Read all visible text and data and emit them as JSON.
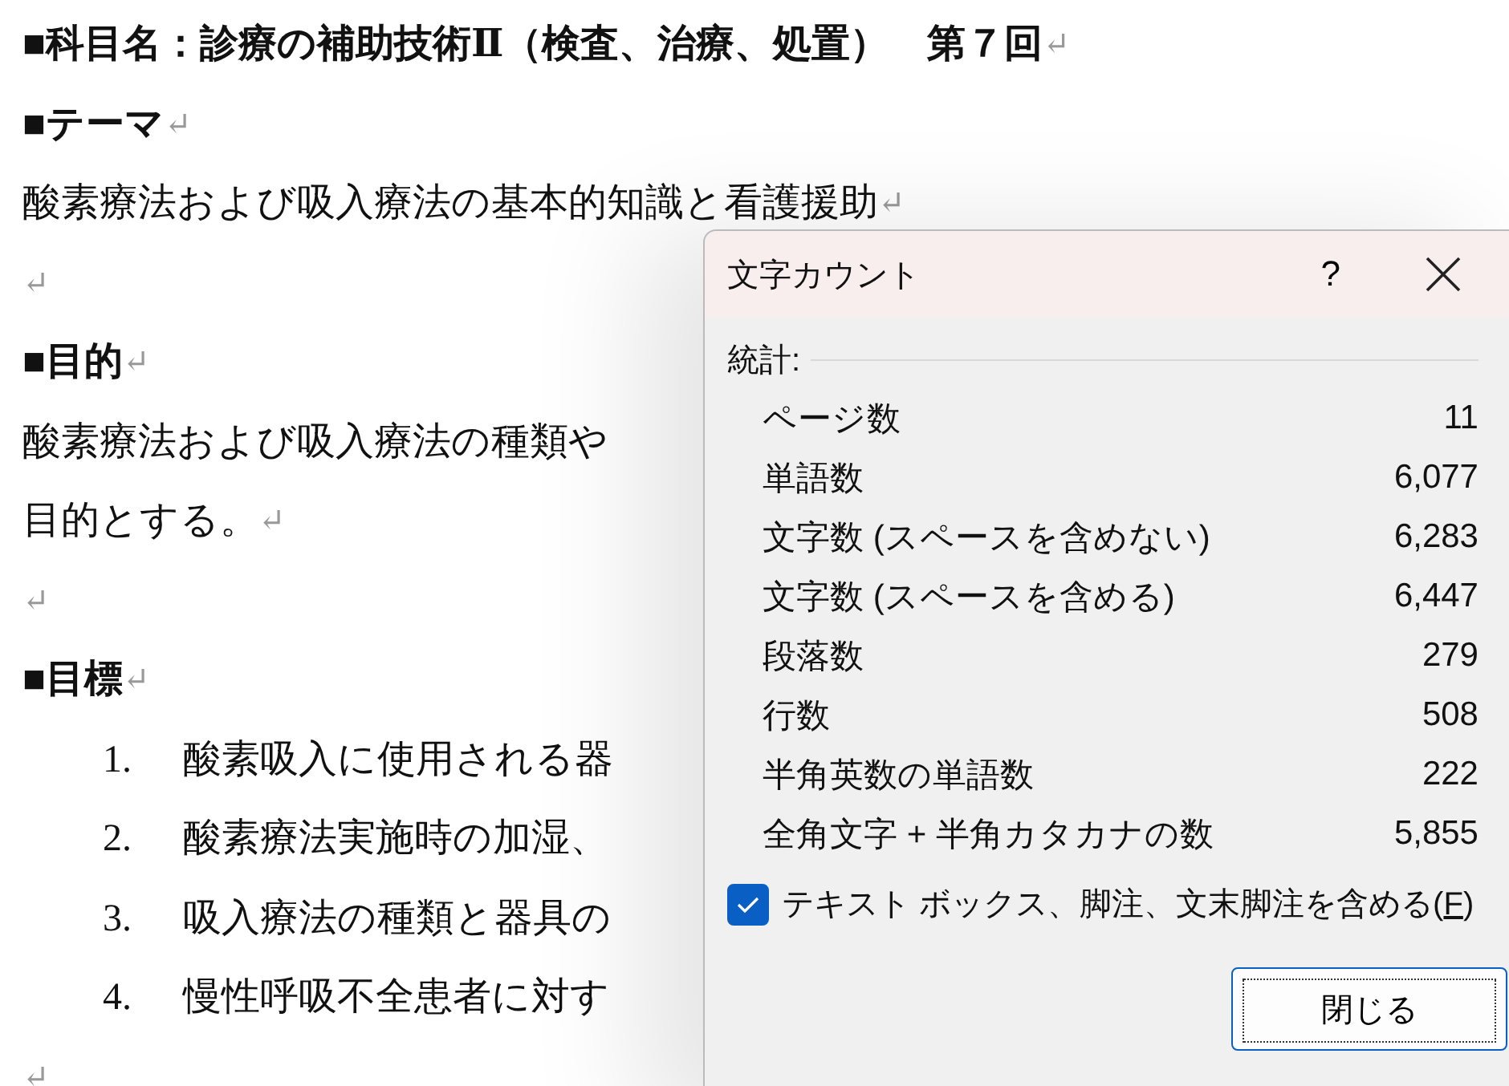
{
  "document": {
    "paragraphs": [
      {
        "kind": "heading",
        "text": "■科目名：診療の補助技術Ⅱ（検査、治療、処置）　第７回",
        "end_mark": "↵"
      },
      {
        "kind": "heading",
        "text": "■テーマ",
        "end_mark": "↵"
      },
      {
        "kind": "body",
        "text": "酸素療法および吸入療法の基本的知識と看護援助",
        "end_mark": "↵"
      },
      {
        "kind": "empty",
        "end_mark": "↵"
      },
      {
        "kind": "heading",
        "text": "■目的",
        "end_mark": "↵"
      },
      {
        "kind": "body",
        "text": "酸素療法および吸入療法の種類や"
      },
      {
        "kind": "body",
        "text": "目的とする。",
        "end_mark": "↵"
      },
      {
        "kind": "empty",
        "end_mark": "↵"
      },
      {
        "kind": "heading",
        "text": "■目標",
        "end_mark": "↵"
      },
      {
        "kind": "list",
        "number": "1.",
        "text": "酸素吸入に使用される器"
      },
      {
        "kind": "list",
        "number": "2.",
        "text": "酸素療法実施時の加湿、"
      },
      {
        "kind": "list",
        "number": "3.",
        "text": "吸入療法の種類と器具の"
      },
      {
        "kind": "list",
        "number": "4.",
        "text": "慢性呼吸不全患者に対す"
      },
      {
        "kind": "empty",
        "end_mark": "↵"
      }
    ]
  },
  "dialog": {
    "title": "文字カウント",
    "help": "?",
    "section": "統計:",
    "stats": [
      {
        "label": "ページ数",
        "value": "11"
      },
      {
        "label": "単語数",
        "value": "6,077"
      },
      {
        "label": "文字数 (スペースを含めない)",
        "value": "6,283"
      },
      {
        "label": "文字数 (スペースを含める)",
        "value": "6,447"
      },
      {
        "label": "段落数",
        "value": "279"
      },
      {
        "label": "行数",
        "value": "508"
      },
      {
        "label": "半角英数の単語数",
        "value": "222"
      },
      {
        "label": "全角文字 + 半角カタカナの数",
        "value": "5,855"
      }
    ],
    "checkbox": {
      "label_parts": [
        "テキスト ボックス、脚注、文末脚注を含める(",
        "F",
        ")"
      ],
      "checked": true
    },
    "button": "閉じる"
  }
}
